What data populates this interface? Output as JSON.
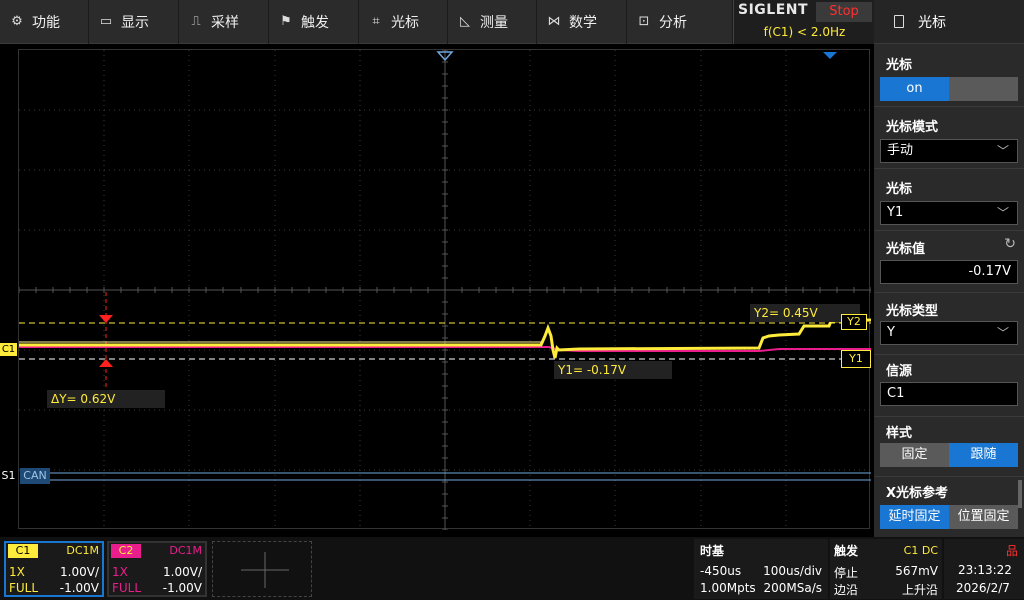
{
  "menu": [
    {
      "icon": "gear-icon",
      "glyph": "⚙",
      "label": "功能"
    },
    {
      "icon": "monitor-icon",
      "glyph": "▭",
      "label": "显示"
    },
    {
      "icon": "acquire-icon",
      "glyph": "⎍",
      "label": "采样"
    },
    {
      "icon": "flag-icon",
      "glyph": "⚑",
      "label": "触发"
    },
    {
      "icon": "cursor-icon",
      "glyph": "⌗",
      "label": "光标"
    },
    {
      "icon": "measure-icon",
      "glyph": "◺",
      "label": "测量"
    },
    {
      "icon": "math-icon",
      "glyph": "⋈",
      "label": "数学"
    },
    {
      "icon": "analysis-icon",
      "glyph": "⊡",
      "label": "分析"
    }
  ],
  "brand": {
    "logo": "SIGLENT",
    "run_state": "Stop",
    "trigger_freq": "f(C1) < 2.0Hz"
  },
  "panel": {
    "title": "光标",
    "cursor_label": "光标",
    "cursor_on": "on",
    "cursor_off": "",
    "mode_label": "光标模式",
    "mode_value": "手动",
    "select_label": "光标",
    "select_value": "Y1",
    "value_label": "光标值",
    "value_value": "-0.17V",
    "type_label": "光标类型",
    "type_value": "Y",
    "source_label": "信源",
    "source_value": "C1",
    "style_label": "样式",
    "style_fixed": "固定",
    "style_track": "跟随",
    "xref_label": "X光标参考",
    "xref_delay": "延时固定",
    "xref_pos": "位置固定"
  },
  "screen": {
    "y2_label": "Y2= 0.45V",
    "y1_label": "Y1= -0.17V",
    "dy_label": "ΔY= 0.62V",
    "y2_tag": "Y2",
    "y1_tag": "Y1",
    "c1_marker": "C1",
    "s1_label": "S1",
    "can_label": "CAN"
  },
  "channels": [
    {
      "name": "C1",
      "coupling": "DC1M",
      "probe": "1X",
      "scale": "1.00V/",
      "bw": "FULL",
      "offset": "-1.00V",
      "color": "#ffeb3b"
    },
    {
      "name": "C2",
      "coupling": "DC1M",
      "probe": "1X",
      "scale": "1.00V/",
      "bw": "FULL",
      "offset": "-1.00V",
      "color": "#e91e8c"
    }
  ],
  "timebase": {
    "title": "时基",
    "delay": "-450us",
    "scale": "100us/div",
    "depth": "1.00Mpts",
    "rate": "200MSa/s"
  },
  "trigger": {
    "title": "触发",
    "source": "C1 DC",
    "state": "停止",
    "level": "567mV",
    "type": "边沿",
    "slope": "上升沿"
  },
  "clock": {
    "time": "23:13:22",
    "date": "2026/2/7"
  },
  "colors": {
    "c1": "#ffeb3b",
    "c2": "#e91e8c",
    "accent": "#1976d2",
    "stop": "#ff3030",
    "cursor": "#ff2020",
    "can": "#6fa8dc"
  }
}
